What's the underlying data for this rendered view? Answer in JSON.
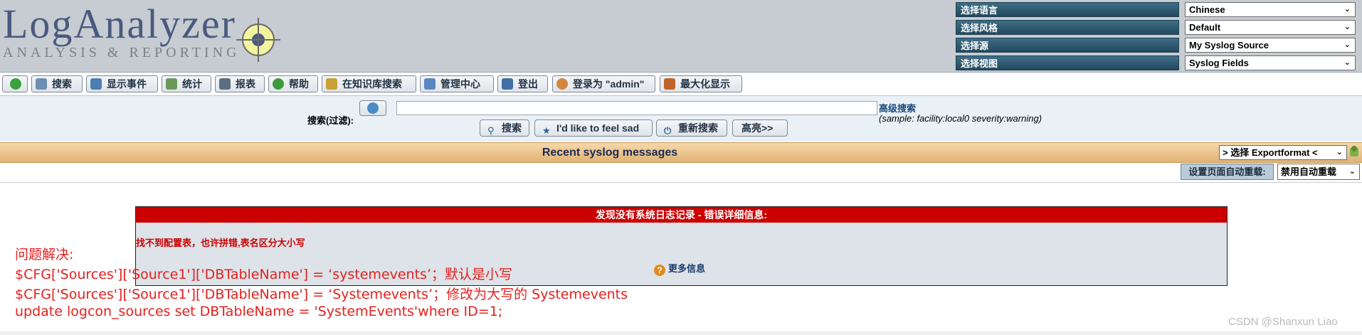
{
  "logo": {
    "main": "LogAnalyzer",
    "sub": "ANALYSIS & REPORTING"
  },
  "selectors": [
    {
      "label": "选择语言",
      "value": "Chinese"
    },
    {
      "label": "选择风格",
      "value": "Default"
    },
    {
      "label": "选择源",
      "value": "My Syslog Source"
    },
    {
      "label": "选择视图",
      "value": "Syslog Fields"
    }
  ],
  "menu": {
    "items": [
      {
        "label": "",
        "icon": "home-icon"
      },
      {
        "label": "搜索",
        "icon": "search-icon"
      },
      {
        "label": "显示事件",
        "icon": "events-icon"
      },
      {
        "label": "统计",
        "icon": "statistics-icon"
      },
      {
        "label": "报表",
        "icon": "reports-icon"
      },
      {
        "label": "帮助",
        "icon": "help-icon"
      },
      {
        "label": "在知识库搜索",
        "icon": "knowledgebase-icon"
      },
      {
        "label": "管理中心",
        "icon": "admin-icon"
      },
      {
        "label": "登出",
        "icon": "logout-icon"
      },
      {
        "label": "登录为 \"admin\"",
        "icon": "user-icon"
      },
      {
        "label": "最大化显示",
        "icon": "maximize-icon"
      }
    ]
  },
  "search": {
    "label": "搜索(过滤):",
    "input_value": "",
    "advanced_link": "高级搜索",
    "sample": "(sample: facility:local0 severity:warning)",
    "buttons": {
      "search": "搜索",
      "feel_sad": "I'd like to feel sad",
      "reset": "重新搜索",
      "highlight": "高亮>>"
    }
  },
  "title_bar": {
    "title": "Recent syslog messages",
    "export_select": "> 选择 Exportformat <"
  },
  "reload": {
    "button": "设置页面自动重载:",
    "select_value": "禁用自动重载"
  },
  "error": {
    "header": "发现没有系统日志记录 - 错误详细信息:",
    "message": "找不到配置表，也许拼错,表名区分大小写",
    "more_info": "更多信息"
  },
  "annotation": {
    "lines": [
      "问题解决:",
      "$CFG['Sources']['Source1']['DBTableName'] =   ‘systemevents’；默认是小写",
      "$CFG['Sources']['Source1']['DBTableName'] =   ‘Systemevents’；修改为大写的 Systemevents",
      "update logcon_sources set DBTableName = 'SystemEvents'where ID=1;"
    ]
  },
  "watermark": "CSDN @Shanxun Liao",
  "colors": {
    "header_bg": "#c7ccd2",
    "selector_label_bg": "#23485d",
    "title_bar_bg": "#e0b276",
    "error_header_bg": "#cc0000",
    "annotation_text": "#e4211f"
  }
}
